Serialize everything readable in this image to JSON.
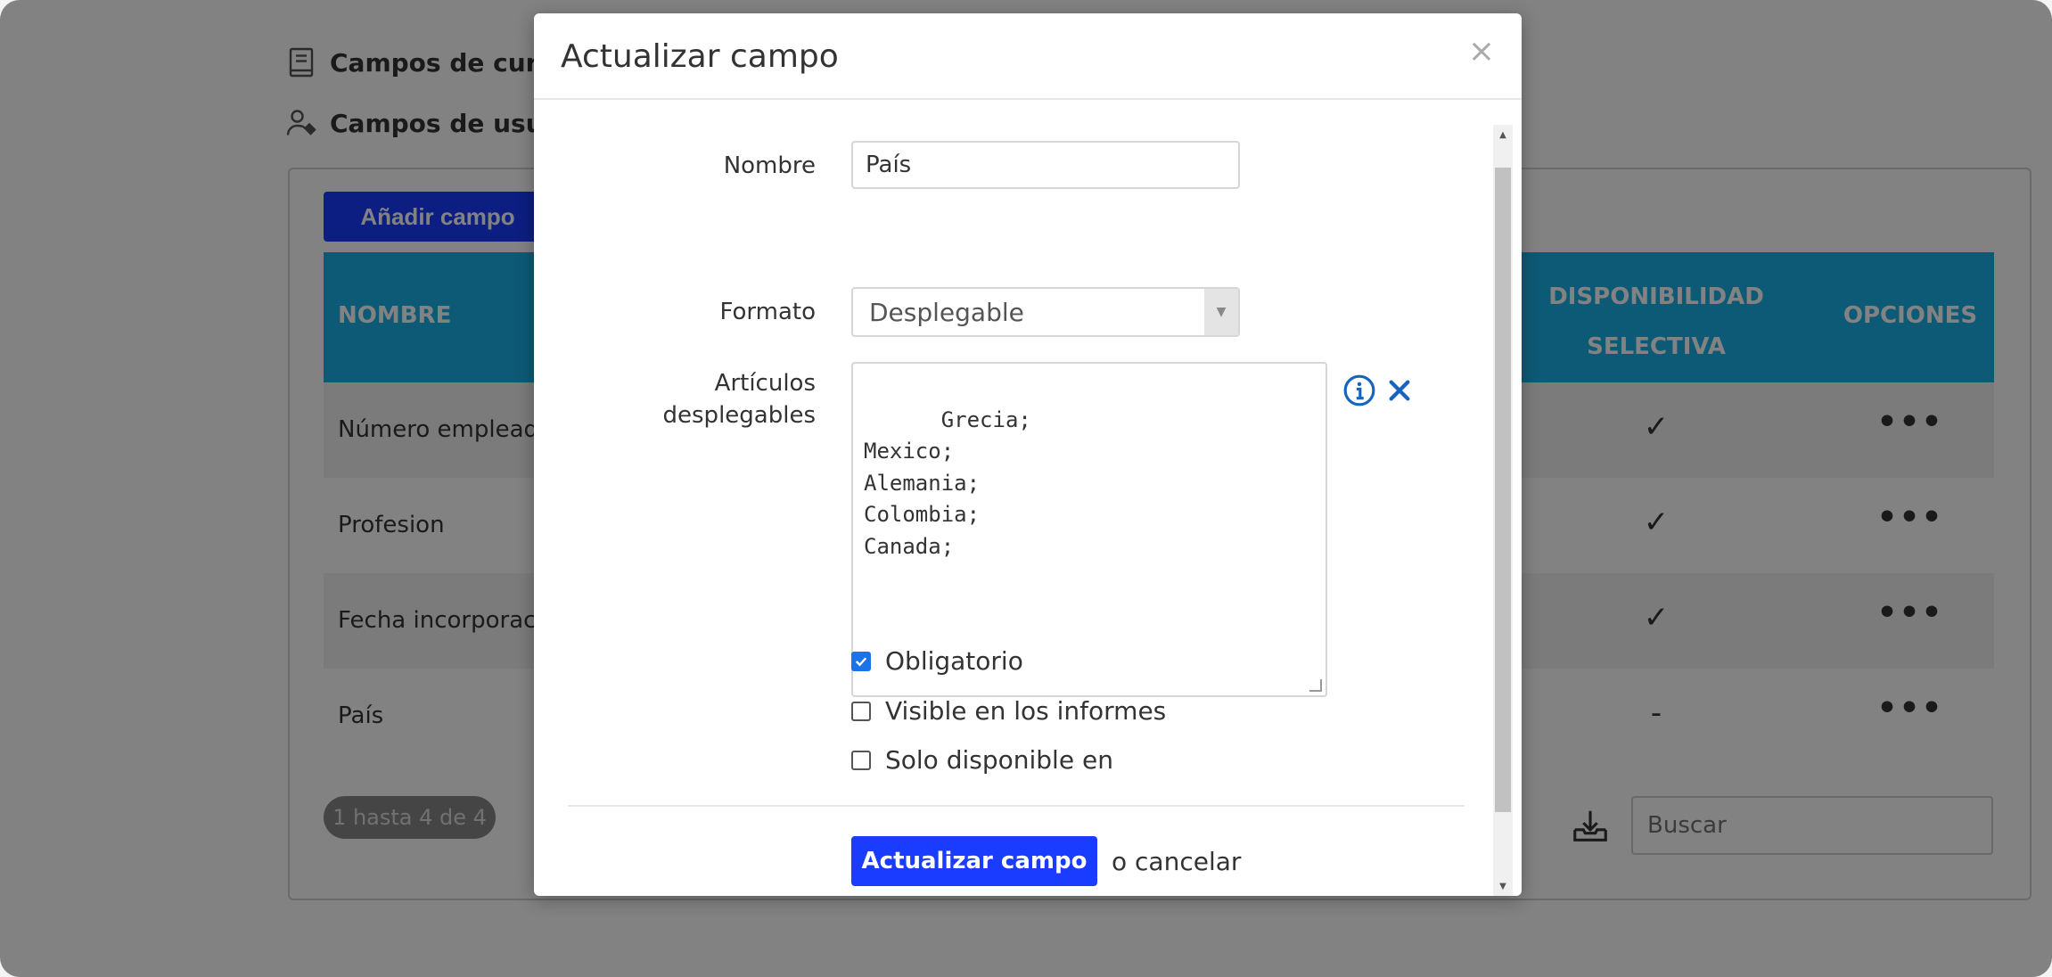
{
  "background": {
    "side_links": [
      {
        "label": "Campos de curs",
        "icon": "book-icon"
      },
      {
        "label": "Campos de usua",
        "icon": "user-tag-icon"
      }
    ],
    "add_button": "Añadir campo",
    "table": {
      "headers": {
        "name": "NOMBRE",
        "disp_line1": "DISPONIBILIDAD",
        "disp_line2": "SELECTIVA",
        "options": "OPCIONES"
      },
      "rows": [
        {
          "name": "Número empleado",
          "selective": "✓",
          "options": "•••"
        },
        {
          "name": "Profesion",
          "selective": "✓",
          "options": "•••"
        },
        {
          "name": "Fecha incorporació",
          "selective": "✓",
          "options": "•••"
        },
        {
          "name": "País",
          "selective": "-",
          "options": "•••"
        }
      ]
    },
    "pagination": "1 hasta 4 de 4",
    "search_placeholder": "Buscar"
  },
  "modal": {
    "title": "Actualizar campo",
    "close": "×",
    "fields": {
      "nombre_label": "Nombre",
      "nombre_value": "País",
      "formato_label": "Formato",
      "formato_value": "Desplegable",
      "articulos_label_1": "Artículos",
      "articulos_label_2": "desplegables",
      "articulos_value": "Grecia;\nMexico;\nAlemania;\nColombia;\nCanada;"
    },
    "checkboxes": [
      {
        "label": "Obligatorio",
        "checked": true
      },
      {
        "label": "Visible en los informes",
        "checked": false
      },
      {
        "label": "Solo disponible en",
        "checked": false
      }
    ],
    "submit": "Actualizar campo",
    "cancel": "o cancelar"
  },
  "colors": {
    "primary": "#1a3cff",
    "header": "#1ab0e8",
    "info_icon": "#1565c0"
  }
}
